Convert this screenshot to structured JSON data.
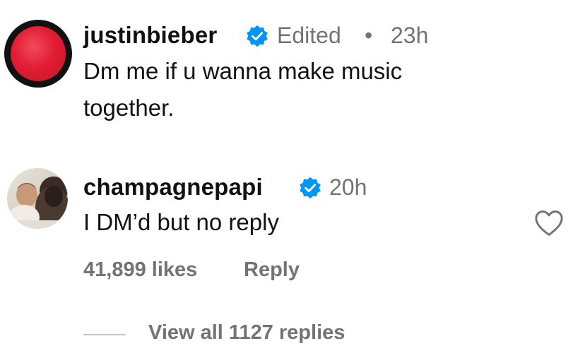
{
  "comments": [
    {
      "username": "justinbieber",
      "verified_icon": "verified-badge-icon",
      "edited_label": "Edited",
      "separator": "•",
      "time": "23h",
      "text_line1": "Dm me if u wanna make music",
      "text_line2": "together."
    },
    {
      "username": "champagnepapi",
      "verified_icon": "verified-badge-icon",
      "time": "20h",
      "text": "I DM’d but no reply",
      "likes": "41,899 likes",
      "reply_label": "Reply",
      "like_icon": "heart-outline-icon",
      "view_replies": "View all 1127 replies"
    }
  ],
  "colors": {
    "verified_blue": "#0095f6",
    "secondary_text": "#737373",
    "primary_text": "#111111"
  }
}
